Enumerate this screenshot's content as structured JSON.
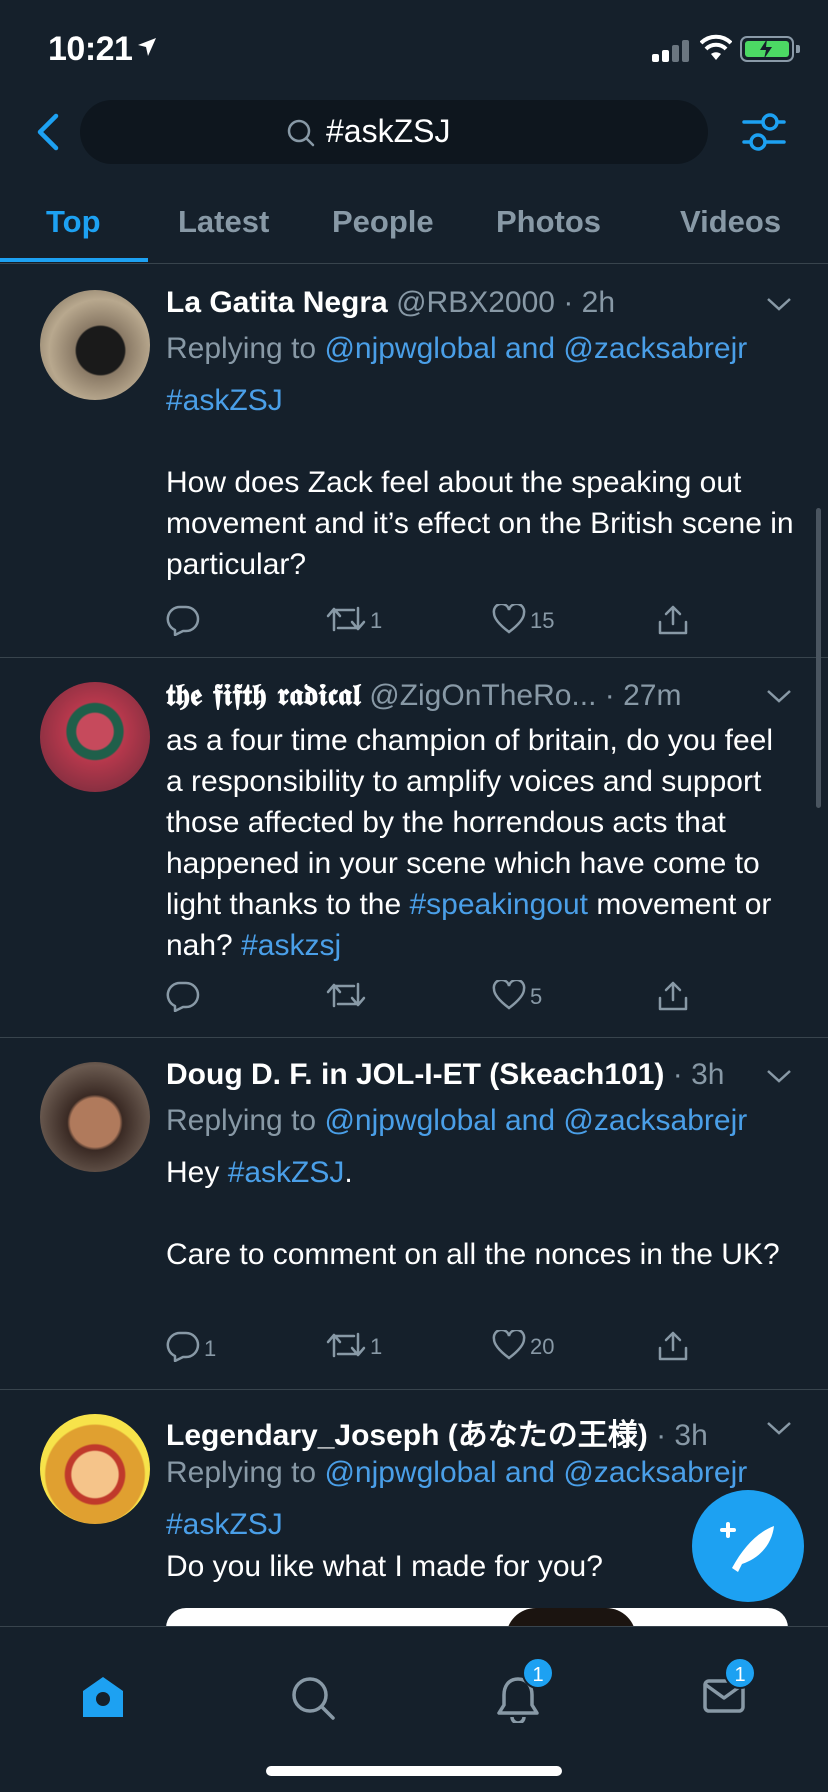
{
  "status_bar": {
    "time": "10:21"
  },
  "search": {
    "query": "#askZSJ"
  },
  "tabs": [
    {
      "label": "Top"
    },
    {
      "label": "Latest"
    },
    {
      "label": "People"
    },
    {
      "label": "Photos"
    },
    {
      "label": "Videos"
    }
  ],
  "tweets": [
    {
      "name": "La Gatita Negra",
      "handle": "@RBX2000",
      "time": "· 2h",
      "replying_prefix": "Replying to ",
      "replying_to": "@njpwglobal and @zacksabrejr",
      "hashtag": "#askZSJ",
      "text": "How does Zack feel about the speaking out movement and it’s effect on the British scene in particular?",
      "replies": "",
      "retweets": "1",
      "likes": "15"
    },
    {
      "name": "𝖙𝖍𝖊 𝖋𝖎𝖋𝖙𝖍 𝖗𝖆𝖉𝖎𝖈𝖆𝖑",
      "handle": "@ZigOnTheRo...",
      "time": "· 27m",
      "text_part1": "as a four time champion of britain, do you feel a responsibility to amplify voices and support those affected by the horrendous acts that happened in your scene which have come to light thanks to the ",
      "hashtag1": "#speakingout",
      "text_part2": " movement or nah? ",
      "hashtag2": "#askzsj",
      "replies": "",
      "retweets": "",
      "likes": "5"
    },
    {
      "name": "Doug D. F. in JOL-I-ET (Skeach101)",
      "handle": "",
      "time": "· 3h",
      "replying_prefix": "Replying to ",
      "replying_to": "@njpwglobal and @zacksabrejr",
      "text_part1": "Hey ",
      "hashtag": "#askZSJ",
      "text_part2": ".",
      "text_part3": "Care to comment on all the nonces in the UK?",
      "replies": "1",
      "retweets": "1",
      "likes": "20"
    },
    {
      "name": "Legendary_Joseph (あなたの王様)",
      "time": "· 3h",
      "replying_prefix": "Replying to ",
      "replying_to": "@njpwglobal and @zacksabrejr",
      "hashtag": "#askZSJ",
      "text": "Do you like what I made for you?"
    }
  ],
  "nav": {
    "notifications_badge": "1",
    "messages_badge": "1"
  },
  "colors": {
    "background": "#15202b",
    "accent": "#1da1f2",
    "muted": "#8899a6",
    "divider": "#38444d"
  }
}
